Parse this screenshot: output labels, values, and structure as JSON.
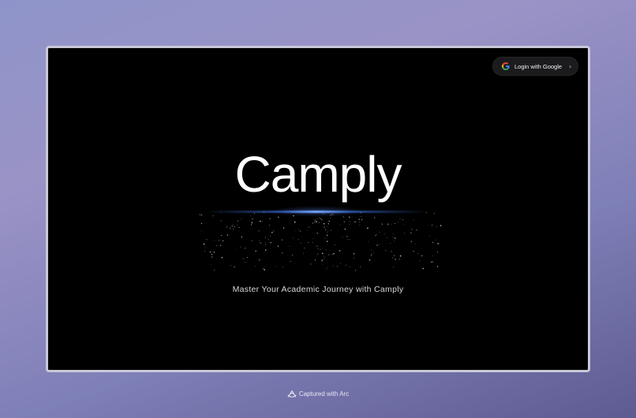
{
  "header": {
    "login_button": {
      "label": "Login with Google",
      "icon": "google-icon",
      "chevron_icon": "chevron-right-icon"
    }
  },
  "hero": {
    "title": "Camply",
    "subtitle": "Master Your Academic Journey with Camply"
  },
  "footer": {
    "label": "Captured with Arc",
    "icon": "arc-icon"
  },
  "colors": {
    "window_bg": "#000000",
    "accent_glow": "#4f86ff",
    "page_gradient_top": "#8e94c9",
    "page_gradient_bottom": "#5e5b91"
  }
}
